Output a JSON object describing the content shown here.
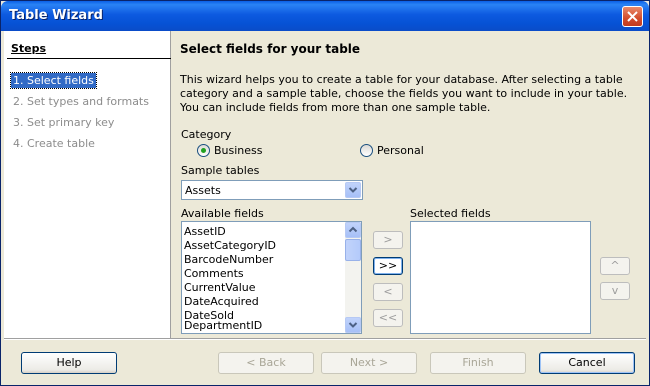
{
  "window": {
    "title": "Table Wizard"
  },
  "steps": {
    "heading": "Steps",
    "items": [
      {
        "label": "1. Select fields",
        "active": true
      },
      {
        "label": "2. Set types and formats",
        "active": false
      },
      {
        "label": "3. Set primary key",
        "active": false
      },
      {
        "label": "4. Create table",
        "active": false
      }
    ]
  },
  "main": {
    "title": "Select fields for your table",
    "intro": "This wizard helps you to create a table for your database. After selecting a table category and a sample table, choose the fields you want to include in your table. You can include fields from more than one sample table.",
    "category": {
      "label": "Category",
      "options": [
        {
          "label": "Business",
          "selected": true
        },
        {
          "label": "Personal",
          "selected": false
        }
      ]
    },
    "sample_tables": {
      "label": "Sample tables",
      "value": "Assets"
    },
    "available_fields": {
      "label": "Available fields",
      "items": [
        "AssetID",
        "AssetCategoryID",
        "BarcodeNumber",
        "Comments",
        "CurrentValue",
        "DateAcquired",
        "DateSold",
        "DepartmentID"
      ]
    },
    "selected_fields": {
      "label": "Selected fields",
      "items": []
    },
    "move_buttons": {
      "add_one": ">",
      "add_all": ">>",
      "remove_one": "<",
      "remove_all": "<<"
    },
    "order_buttons": {
      "up": "^",
      "down": "v"
    }
  },
  "footer": {
    "help": "Help",
    "back": "< Back",
    "next": "Next >",
    "finish": "Finish",
    "cancel": "Cancel"
  },
  "colors": {
    "titlebar": "#0a5fe6",
    "selection": "#316ac5",
    "radio_dot": "#21a121"
  }
}
